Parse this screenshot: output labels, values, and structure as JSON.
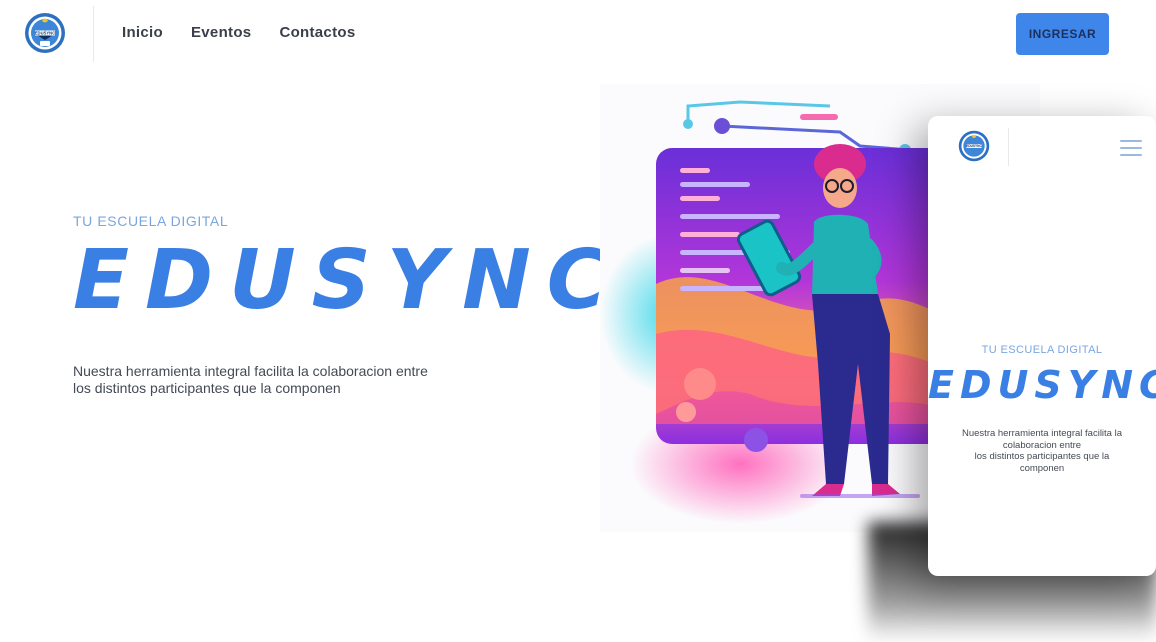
{
  "brand": {
    "logo_text": "EDUSYNC",
    "icon": "school-crest-logo"
  },
  "header": {
    "nav": [
      {
        "label": "Inicio"
      },
      {
        "label": "Eventos"
      },
      {
        "label": "Contactos"
      }
    ],
    "login_label": "INGRESAR"
  },
  "hero": {
    "kicker": "TU ESCUELA DIGITAL",
    "title": "EDUSYNC",
    "description_lines": [
      "Nuestra herramienta integral facilita la colaboracion entre",
      "los distintos participantes que la componen"
    ],
    "illustration": "woman-with-tablet-illustration"
  },
  "mobile_preview": {
    "menu_icon": "hamburger-menu-icon",
    "kicker": "TU ESCUELA DIGITAL",
    "title": "EDUSYNC",
    "description_lines": [
      "Nuestra herramienta integral facilita la",
      "colaboracion entre",
      "los distintos participantes que la",
      "componen"
    ]
  },
  "colors": {
    "accent": "#3a7fe3",
    "button": "#3f86ea",
    "kicker": "#7aa6de",
    "text": "#444a55"
  }
}
